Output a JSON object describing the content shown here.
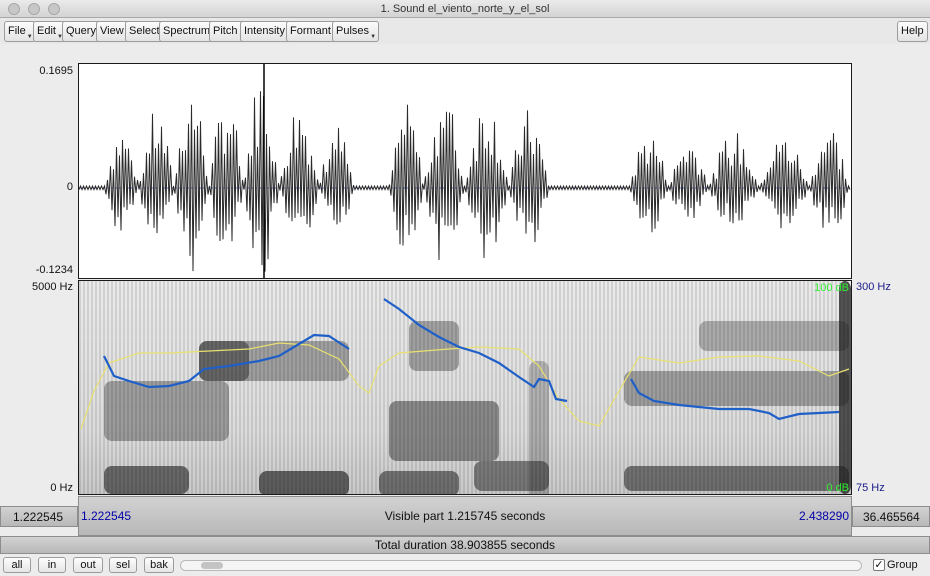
{
  "window": {
    "title": "1. Sound el_viento_norte_y_el_sol"
  },
  "menu": {
    "items": [
      "File",
      "Edit",
      "Query",
      "View",
      "Select",
      "Spectrum",
      "Pitch",
      "Intensity",
      "Formant",
      "Pulses"
    ],
    "help": "Help"
  },
  "waveform": {
    "max_label": "0.1695",
    "zero_label": "0",
    "min_label": "-0.1234"
  },
  "spectrogram": {
    "top_freq": "5000 Hz",
    "bottom_freq": "0 Hz",
    "intensity_top": "100 dB",
    "intensity_bottom": "0 dB",
    "pitch_top": "300 Hz",
    "pitch_bottom": "75 Hz"
  },
  "visible_bar": {
    "left_outside": "1.222545",
    "start": "1.222545",
    "label": "Visible part 1.215745 seconds",
    "end": "2.438290",
    "right_outside": "36.465564"
  },
  "total_bar": {
    "label": "Total duration 38.903855 seconds"
  },
  "bottom": {
    "buttons": [
      "all",
      "in",
      "out",
      "sel",
      "bak"
    ],
    "group_label": "Group",
    "group_checked": true
  },
  "colors": {
    "pitch": "#1f5fc8",
    "intensity": "#e8e070",
    "intensity_label": "#33ee33",
    "time_label": "#0000aa"
  }
}
